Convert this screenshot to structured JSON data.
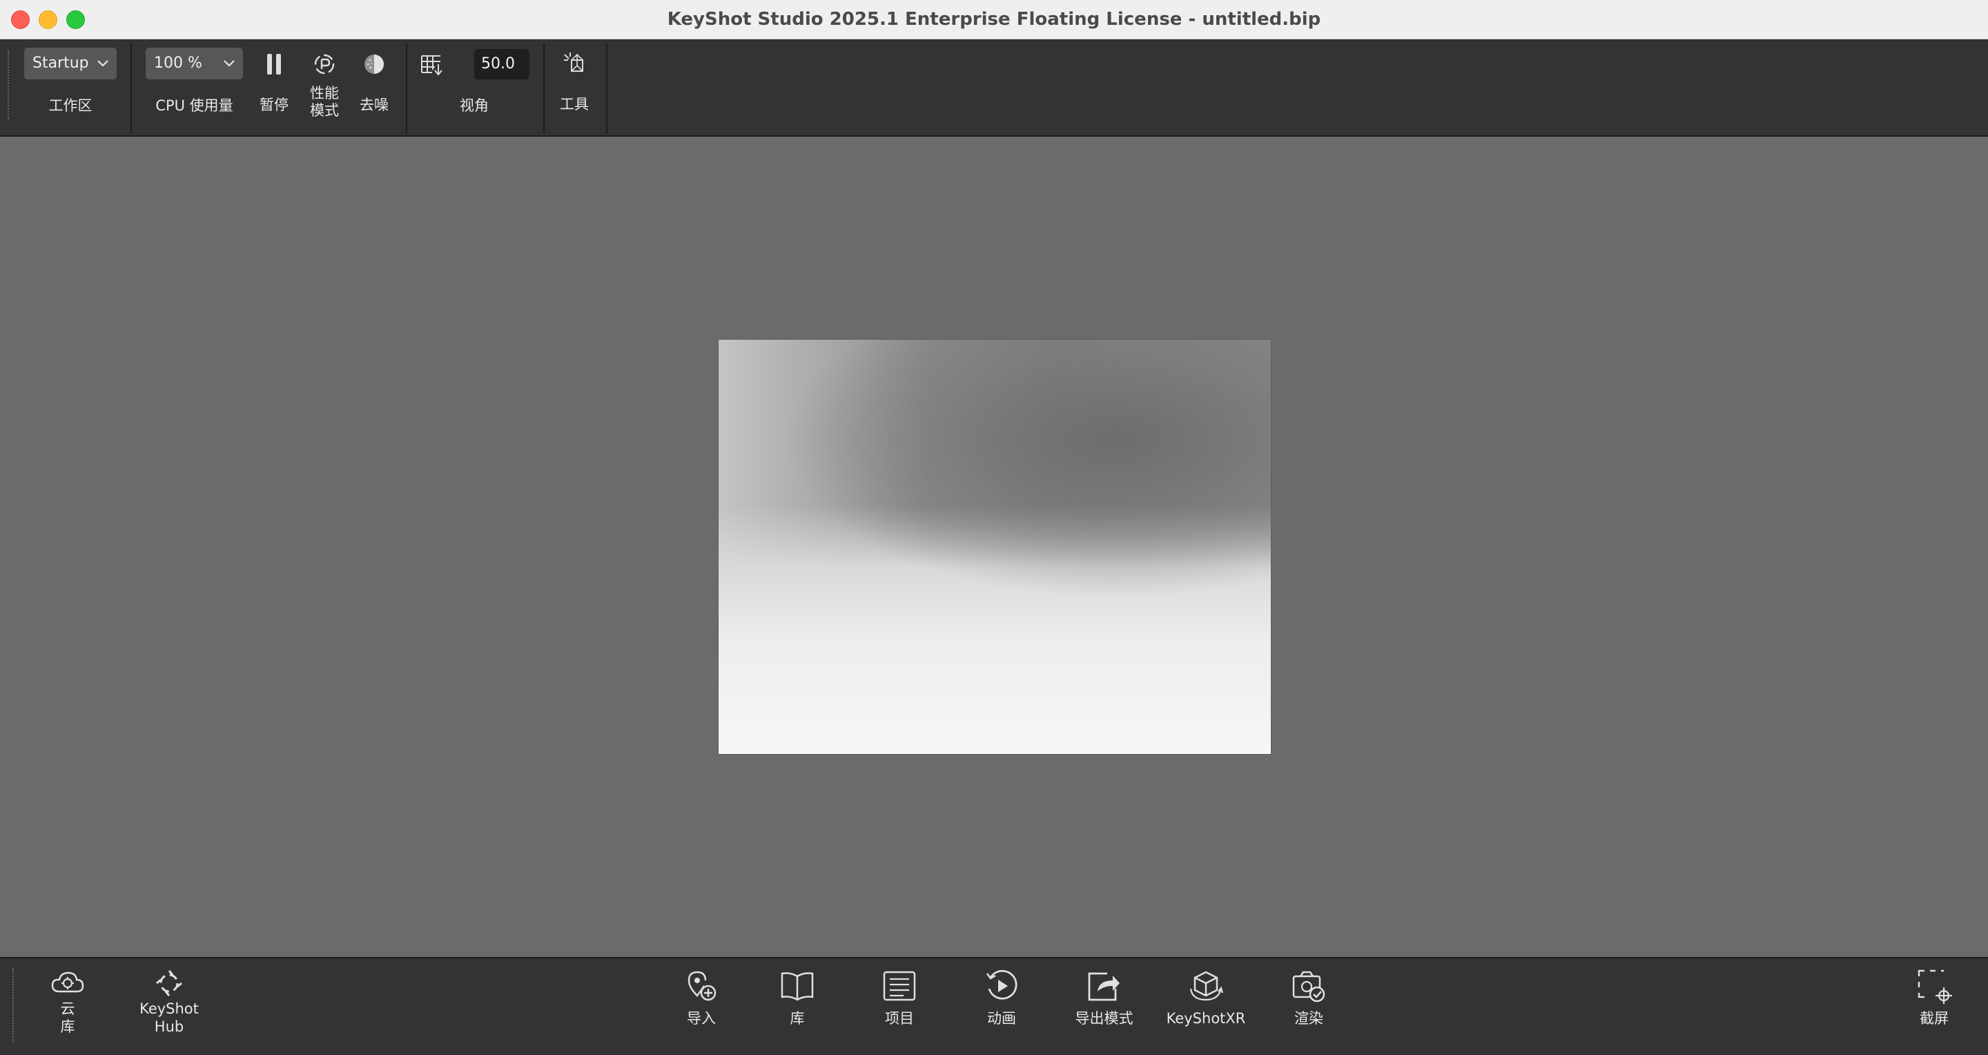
{
  "window": {
    "title": "KeyShot Studio 2025.1 Enterprise Floating License  - untitled.bip"
  },
  "toolbar": {
    "workspace": {
      "value": "Startup",
      "label": "工作区"
    },
    "cpu": {
      "value": "100 %",
      "label": "CPU 使用量"
    },
    "pause": {
      "label": "暂停",
      "icon": "pause-icon"
    },
    "performance": {
      "label_line1": "性能",
      "label_line2": "模式",
      "icon": "performance-mode-icon"
    },
    "denoise": {
      "label": "去噪",
      "icon": "denoise-icon"
    },
    "fov": {
      "value": "50.0",
      "label": "视角",
      "icon": "perspective-grid-icon"
    },
    "tools": {
      "label": "工具",
      "icon": "tools-icon"
    }
  },
  "dock": {
    "cloud_library": {
      "label_line1": "云",
      "label_line2": "库",
      "icon": "cloud-icon"
    },
    "keyshot_hub": {
      "label_line1": "KeyShot",
      "label_line2": "Hub",
      "icon": "keyshot-hub-icon"
    },
    "import": {
      "label": "导入",
      "icon": "import-icon"
    },
    "library": {
      "label": "库",
      "icon": "book-icon"
    },
    "project": {
      "label": "项目",
      "icon": "project-list-icon"
    },
    "animation": {
      "label": "动画",
      "icon": "animation-play-icon"
    },
    "export_mode": {
      "label": "导出模式",
      "icon": "share-export-icon"
    },
    "keyshotxr": {
      "label": "KeyShotXR",
      "icon": "xr-cube-icon"
    },
    "render": {
      "label": "渲染",
      "icon": "render-camera-icon"
    },
    "screenshot": {
      "label": "截屏",
      "icon": "screenshot-crosshair-icon"
    }
  }
}
